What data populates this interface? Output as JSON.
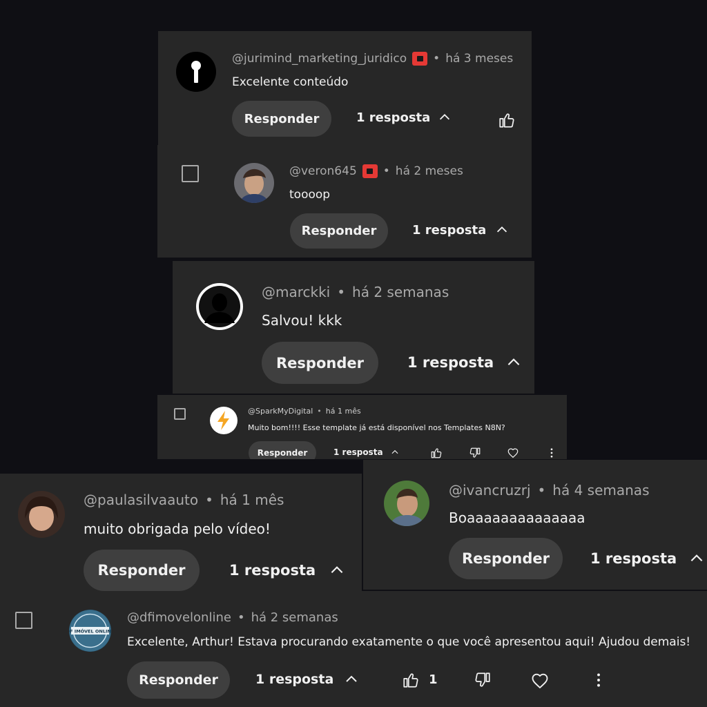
{
  "comments": {
    "c1": {
      "handle": "@jurimind_marketing_juridico",
      "time": "há 3 meses",
      "text": "Excelente conteúdo",
      "reply_label": "Responder",
      "replies": "1 resposta"
    },
    "c2": {
      "handle": "@veron645",
      "time": "há 2 meses",
      "text": "toooop",
      "reply_label": "Responder",
      "replies": "1 resposta"
    },
    "c3": {
      "handle": "@marckki",
      "time": "há 2 semanas",
      "text": "Salvou! kkk",
      "reply_label": "Responder",
      "replies": "1 resposta"
    },
    "c4": {
      "handle": "@SparkMyDigital",
      "time": "há 1 mês",
      "text": "Muito bom!!!! Esse template já está disponível nos Templates N8N?",
      "reply_label": "Responder",
      "replies": "1 resposta"
    },
    "c5": {
      "handle": "@paulasilvaauto",
      "time": "há 1 mês",
      "text": "muito obrigada pelo vídeo!",
      "reply_label": "Responder",
      "replies": "1 resposta"
    },
    "c6": {
      "handle": "@ivancruzrj",
      "time": "há 4 semanas",
      "text": "Boaaaaaaaaaaaaaa",
      "reply_label": "Responder",
      "replies": "1 resposta"
    },
    "c7": {
      "handle": "@dfimovelonline",
      "time": "há 2 semanas",
      "text": "Excelente, Arthur! Estava procurando exatamente o que você apresentou aqui! Ajudou demais!",
      "reply_label": "Responder",
      "replies": "1 resposta",
      "like_count": "1"
    }
  },
  "separator": "•",
  "icons": {
    "like": "thumbs-up-icon",
    "dislike": "thumbs-down-icon",
    "heart": "heart-icon",
    "more": "more-vertical-icon",
    "chevron": "chevron-up-icon",
    "badge": "member-badge-icon",
    "checkbox": "checkbox-icon"
  },
  "colors": {
    "background": "#0f0f14",
    "card": "#272727",
    "button": "#3f3f3f",
    "badge": "#e53935",
    "muted": "#aaaaaa"
  },
  "avatar_logo_text": "DF IMÓVEL ONLINE"
}
